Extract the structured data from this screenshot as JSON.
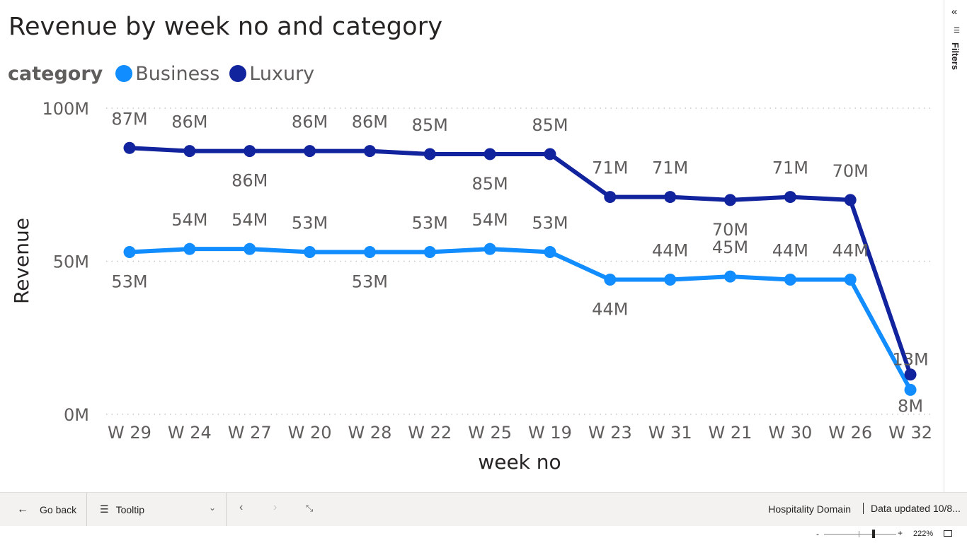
{
  "chart_data": {
    "type": "line",
    "title": "Revenue by week no and category",
    "xlabel": "week no",
    "ylabel": "Revenue",
    "ylim": [
      0,
      100
    ],
    "y_ticks": [
      "0M",
      "50M",
      "100M"
    ],
    "y_tick_values": [
      0,
      50,
      100
    ],
    "legend_title": "category",
    "legend_position": "top-left",
    "grid": true,
    "categories": [
      "W 29",
      "W 24",
      "W 27",
      "W 20",
      "W 28",
      "W 22",
      "W 25",
      "W 19",
      "W 23",
      "W 31",
      "W 21",
      "W 30",
      "W 26",
      "W 32"
    ],
    "series": [
      {
        "name": "Business",
        "color": "#118dff",
        "values": [
          53,
          54,
          54,
          53,
          53,
          53,
          54,
          53,
          44,
          44,
          45,
          44,
          44,
          8
        ],
        "labels": [
          "53M",
          "54M",
          "54M",
          "53M",
          "53M",
          "53M",
          "54M",
          "53M",
          "44M",
          "44M",
          "45M",
          "44M",
          "44M",
          "8M"
        ]
      },
      {
        "name": "Luxury",
        "color": "#12239e",
        "values": [
          87,
          86,
          86,
          86,
          86,
          85,
          85,
          85,
          71,
          71,
          70,
          71,
          70,
          13
        ],
        "labels": [
          "87M",
          "86M",
          "86M",
          "86M",
          "86M",
          "85M",
          "85M",
          "85M",
          "71M",
          "71M",
          "70M",
          "71M",
          "70M",
          "13M"
        ]
      }
    ]
  },
  "filters_pane": {
    "label": "Filters"
  },
  "bottom_bar": {
    "go_back": "Go back",
    "page": "Tooltip",
    "report_name": "Hospitality Domain",
    "data_updated": "Data updated 10/8..."
  },
  "status_bar": {
    "zoom": "222%"
  }
}
